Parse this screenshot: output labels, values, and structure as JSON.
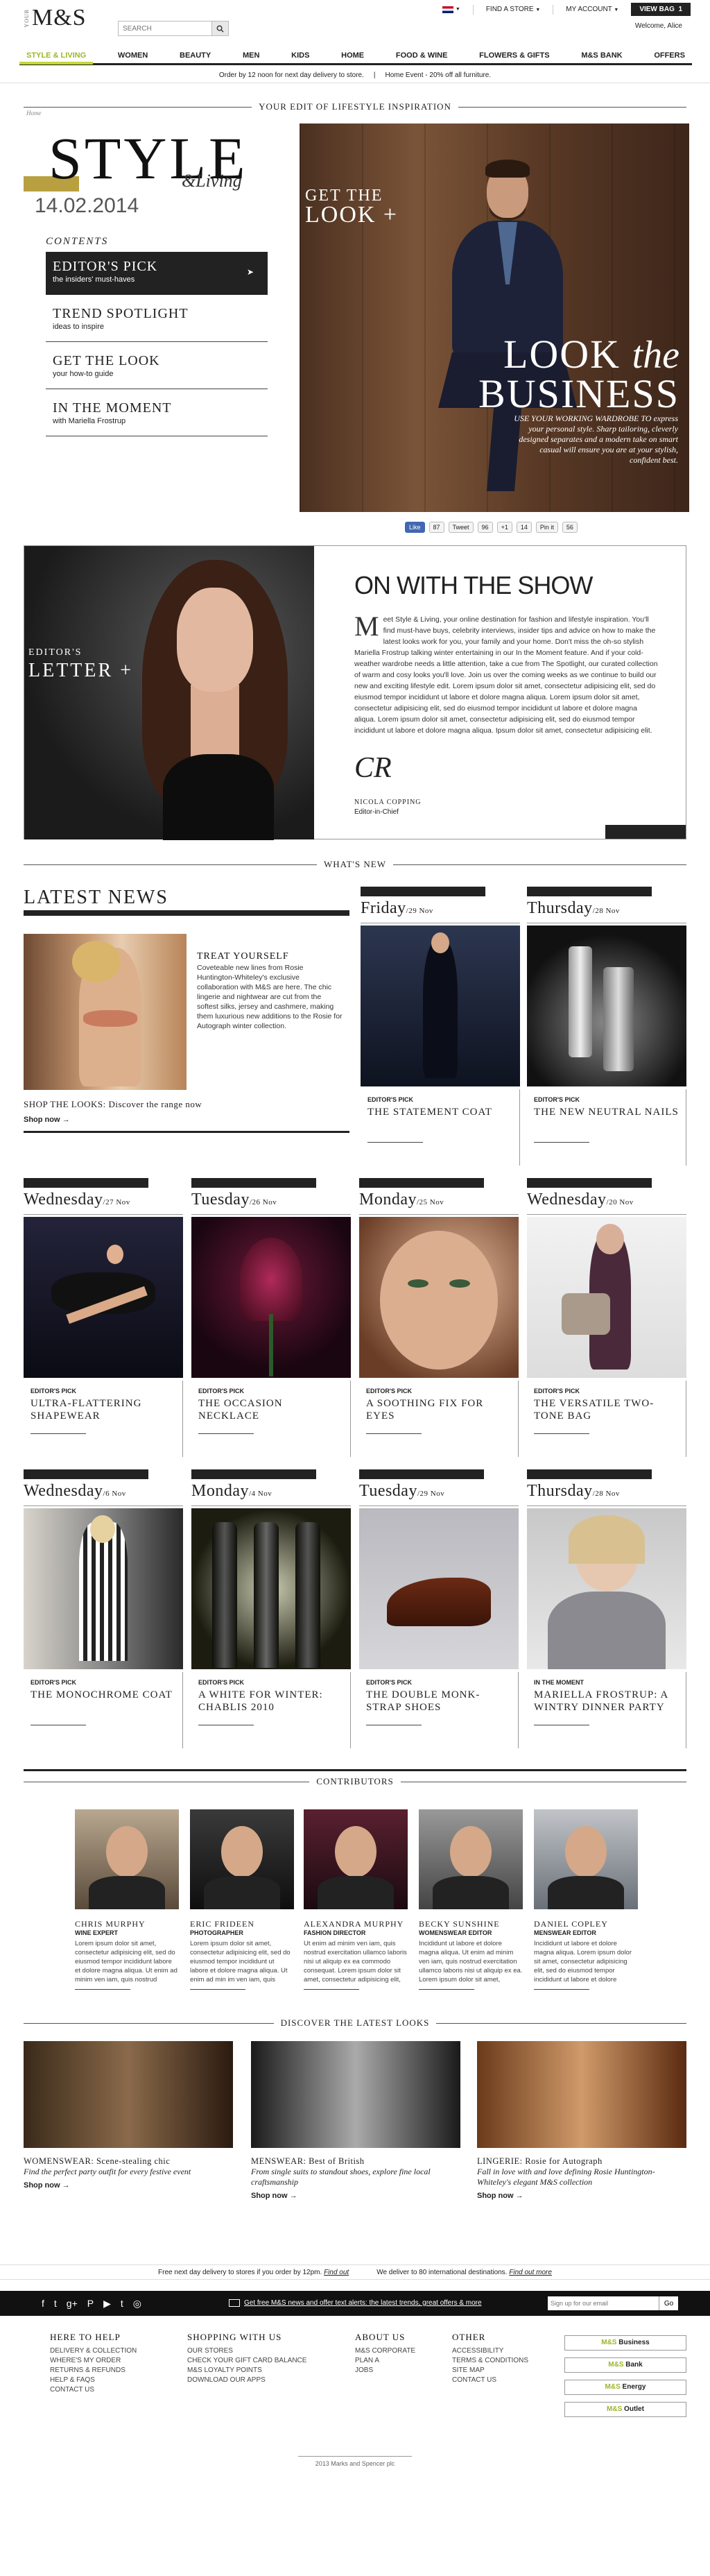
{
  "header": {
    "logo_your": "YOUR",
    "logo_brand": "M&S",
    "search_placeholder": "SEARCH",
    "find_store": "FIND A STORE",
    "my_account": "MY ACCOUNT",
    "view_bag": "VIEW BAG",
    "bag_count": "1",
    "welcome": "Welcome, Alice"
  },
  "nav": [
    "STYLE & LIVING",
    "WOMEN",
    "BEAUTY",
    "MEN",
    "KIDS",
    "HOME",
    "FOOD & WINE",
    "FLOWERS & GIFTS",
    "M&S BANK",
    "OFFERS"
  ],
  "promo": {
    "left": "Order by 12 noon for next day delivery to store.",
    "sep": "|",
    "right": "Home Event - 20% off all furniture."
  },
  "sections": {
    "edit": "YOUR EDIT OF LIFESTYLE INSPIRATION",
    "whatsnew": "WHAT'S NEW",
    "contributors": "CONTRIBUTORS",
    "looks": "DISCOVER THE LATEST LOOKS"
  },
  "hero": {
    "crumb": "Home",
    "title": "STYLE",
    "subtitle": "&Living",
    "date": "14.02.2014",
    "contents_label": "CONTENTS",
    "contents": [
      {
        "title": "EDITOR'S PICK",
        "sub": "the insiders' must-haves"
      },
      {
        "title": "TREND SPOTLIGHT",
        "sub": "ideas to inspire"
      },
      {
        "title": "GET THE LOOK",
        "sub": "your how-to guide"
      },
      {
        "title": "IN THE MOMENT",
        "sub": "with Mariella Frostrup"
      }
    ],
    "gtl_small": "GET THE",
    "gtl_big": "LOOK +",
    "look_the": "LOOK",
    "look_the_i": "the",
    "business": "BUSINESS",
    "description": "USE YOUR WORKING WARDROBE TO express your personal style. Sharp tailoring, cleverly designed separates and a modern take on smart casual will ensure you are at your stylish, confident best."
  },
  "social": {
    "like": "Like",
    "like_count": "87",
    "tweet": "Tweet",
    "tweet_count": "96",
    "gplus": "+1",
    "gplus_count": "14",
    "pin": "Pin it",
    "pin_count": "56"
  },
  "letter": {
    "eds": "EDITOR'S",
    "ltr": "LETTER +",
    "title": "ON WITH THE SHOW",
    "drop": "M",
    "body": "eet Style & Living, your online destination for fashion and lifestyle inspiration. You'll find must-have buys, celebrity interviews, insider tips and advice on how to make the latest looks work for you, your family and your home. Don't miss the oh-so stylish Mariella Frostrup talking winter entertaining in our In the Moment feature. And if your cold-weather wardrobe needs a little attention, take a cue from The Spotlight, our curated collection of warm and cosy looks you'll love. Join us over the coming weeks as we continue to build our new and exciting lifestyle edit. Lorem ipsum dolor sit amet, consectetur adipisicing elit, sed do eiusmod tempor incididunt ut labore et dolore magna aliqua. Lorem ipsum dolor sit amet, consectetur adipisicing elit, sed do eiusmod tempor incididunt ut labore et dolore magna aliqua. Lorem ipsum dolor sit amet, consectetur adipisicing elit, sed do eiusmod tempor incididunt ut labore et dolore magna aliqua. Ipsum dolor sit amet, consectetur adipisicing elit.",
    "sig": "CR",
    "name": "NICOLA COPPING",
    "role": "Editor-in-Chief"
  },
  "news": {
    "title": "LATEST NEWS",
    "h": "TREAT YOURSELF",
    "body": "Coveteable new lines from Rosie Huntington-Whiteley's exclusive collaboration with M&S are here. The chic lingerie and nightwear are cut from the softest silks, jersey and cashmere, making them luxurious new additions to the Rosie for Autograph winter collection.",
    "shop": "SHOP THE LOOKS: Discover the range now",
    "shop_now": "Shop now →"
  },
  "cards": [
    {
      "day": "Friday",
      "date": "/29 Nov",
      "tag": "EDITOR'S PICK",
      "title": "THE STATEMENT COAT"
    },
    {
      "day": "Thursday",
      "date": "/28 Nov",
      "tag": "EDITOR'S PICK",
      "title": "THE NEW NEUTRAL NAILS"
    },
    {
      "day": "Wednesday",
      "date": "/27 Nov",
      "tag": "EDITOR'S PICK",
      "title": "ULTRA-FLATTERING SHAPEWEAR"
    },
    {
      "day": "Tuesday",
      "date": "/26 Nov",
      "tag": "EDITOR'S PICK",
      "title": "THE OCCASION NECKLACE"
    },
    {
      "day": "Monday",
      "date": "/25 Nov",
      "tag": "EDITOR'S PICK",
      "title": "A SOOTHING FIX FOR EYES"
    },
    {
      "day": "Wednesday",
      "date": "/20 Nov",
      "tag": "EDITOR'S PICK",
      "title": "THE VERSATILE TWO-TONE BAG"
    },
    {
      "day": "Wednesday",
      "date": "/6 Nov",
      "tag": "EDITOR'S PICK",
      "title": "THE MONOCHROME COAT"
    },
    {
      "day": "Monday",
      "date": "/4 Nov",
      "tag": "EDITOR'S PICK",
      "title": "A WHITE FOR WINTER: CHABLIS 2010"
    },
    {
      "day": "Tuesday",
      "date": "/29 Nov",
      "tag": "EDITOR'S PICK",
      "title": "THE DOUBLE MONK-STRAP SHOES"
    },
    {
      "day": "Thursday",
      "date": "/28 Nov",
      "tag": "IN THE MOMENT",
      "title": "MARIELLA FROSTRUP: A WINTRY DINNER PARTY"
    }
  ],
  "contributors": [
    {
      "name": "CHRIS MURPHY",
      "role": "WINE EXPERT",
      "text": "Lorem ipsum dolor sit amet, consectetur adipisicing elit, sed do eiusmod tempor incididunt labore et dolore magna aliqua. Ut enim ad minim ven iam, quis nostrud exercitation ullamco laboris nisi ut aliquip ex ea"
    },
    {
      "name": "ERIC FRIDEEN",
      "role": "PHOTOGRAPHER",
      "text": "Lorem ipsum dolor sit amet, consectetur adipisicing elit, sed do eiusmod tempor incididunt ut labore et dolore magna aliqua. Ut enim ad min im ven iam, quis nostrud exercitation ullamco laboris nisi ut aliquip ex ea commodo consequat. Duis aute irure dolor"
    },
    {
      "name": "ALEXANDRA MURPHY",
      "role": "FASHION DIRECTOR",
      "text": "Ut enim ad minim ven iam, quis nostrud exercitation ullamco laboris nisi ut aliquip ex ea commodo consequat. Lorem ipsum dolor sit amet, consectetur adipisicing elit, sed do eiusmod tempor incididunt ut labore et dolore magna aliqua. Ut enim ad minim ven iam, quis nostrud"
    },
    {
      "name": "BECKY SUNSHINE",
      "role": "WOMENSWEAR EDITOR",
      "text": "Incididunt ut labore et dolore magna aliqua. Ut enim ad minim ven iam, quis nostrud exercitation ullamco laboris nisi ut aliquip ex ea. Lorem ipsum dolor sit amet, consectetur adipisicing elit, sed do eiusmod tempor incididunt ut labore et dolore magna aliqua. Ut enim ad minim ven iam, quis nostrud exercitation ullamco laboris nisi ut aliquip ex ea."
    },
    {
      "name": "DANIEL COPLEY",
      "role": "MENSWEAR EDITOR",
      "text": "Incididunt ut labore et dolore magna aliqua. Lorem ipsum dolor sit amet, consectetur adipisicing elit, sed do eiusmod tempor incididunt ut labore et dolore magna aliqua. Ut enim ad minim ven iam, quis nostrud exercitation ullamco laboris nisi ut aliquip ex ea."
    }
  ],
  "looks": [
    {
      "h": "WOMENSWEAR: Scene-stealing chic",
      "d": "Find the perfect party outfit for every festive event",
      "sn": "Shop now →"
    },
    {
      "h": "MENSWEAR: Best of British",
      "d": "From single suits to standout shoes, explore fine local craftsmanship",
      "sn": "Shop now →"
    },
    {
      "h": "LINGERIE: Rosie for Autograph",
      "d": "Fall in love with and love defining Rosie Huntington-Whiteley's elegant M&S collection",
      "sn": "Shop now →"
    }
  ],
  "delivery": {
    "left": "Free next day delivery to stores if you order by 12pm.",
    "left_link": "Find out",
    "right": "We deliver to 80 international destinations.",
    "right_link": "Find out more"
  },
  "newsletter": {
    "alert": "Get free M&S news and offer text alerts: the latest trends, great offers & more",
    "email_placeholder": "Sign up for our email",
    "go": "Go"
  },
  "social_icons": [
    "f",
    "t",
    "g+",
    "P",
    "▶",
    "t",
    "◎"
  ],
  "footer": {
    "cols": [
      {
        "h": "HERE TO HELP",
        "items": [
          "DELIVERY & COLLECTION",
          "WHERE'S MY ORDER",
          "RETURNS & REFUNDS",
          "HELP & FAQS",
          "CONTACT US"
        ]
      },
      {
        "h": "SHOPPING WITH US",
        "items": [
          "OUR STORES",
          "CHECK YOUR GIFT CARD BALANCE",
          "M&S LOYALTY POINTS",
          "DOWNLOAD OUR APPS"
        ]
      },
      {
        "h": "ABOUT US",
        "items": [
          "M&S CORPORATE",
          "PLAN A",
          "JOBS"
        ]
      },
      {
        "h": "OTHER",
        "items": [
          "ACCESSIBILITY",
          "TERMS & CONDITIONS",
          "SITE MAP",
          "CONTACT US"
        ]
      }
    ],
    "buttons": [
      {
        "a": "M&S",
        "b": " Business"
      },
      {
        "a": "M&S",
        "b": " Bank"
      },
      {
        "a": "M&S",
        "b": " Energy"
      },
      {
        "a": "M&S",
        "b": " Outlet"
      }
    ],
    "copyright": "2013 Marks and Spencer plc"
  }
}
